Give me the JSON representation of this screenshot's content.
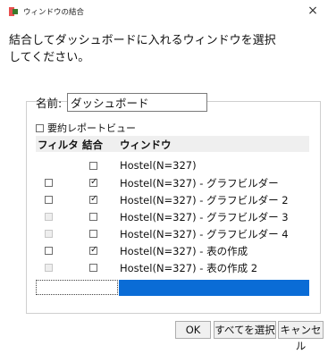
{
  "window": {
    "title": "ウィンドウの結合",
    "close_glyph": "×"
  },
  "instruction": "結合してダッシュボードに入れるウィンドウを選択してください。",
  "name_field": {
    "label": "名前:",
    "value": "ダッシュボード"
  },
  "summary_report": {
    "label": "要約レポートビュー",
    "checked": false
  },
  "grid": {
    "headers": {
      "filter": "フィルタ",
      "combine": "結合",
      "window": "ウィンドウ"
    },
    "rows": [
      {
        "filter": "none",
        "combine": false,
        "window": "Hostel(N=327)"
      },
      {
        "filter": false,
        "combine": true,
        "window": "Hostel(N=327) - グラフビルダー"
      },
      {
        "filter": false,
        "combine": true,
        "window": "Hostel(N=327) - グラフビルダー 2"
      },
      {
        "filter": "disabled",
        "combine": false,
        "window": "Hostel(N=327) - グラフビルダー 3"
      },
      {
        "filter": "disabled",
        "combine": false,
        "window": "Hostel(N=327) - グラフビルダー 4"
      },
      {
        "filter": false,
        "combine": true,
        "window": "Hostel(N=327) - 表の作成"
      },
      {
        "filter": "disabled",
        "combine": false,
        "window": "Hostel(N=327) - 表の作成 2"
      }
    ]
  },
  "buttons": {
    "ok": "OK",
    "select_all": "すべてを選択",
    "cancel": "キャンセル"
  },
  "colors": {
    "selection": "#0a6cd6",
    "app_icon": "#e8504f"
  }
}
